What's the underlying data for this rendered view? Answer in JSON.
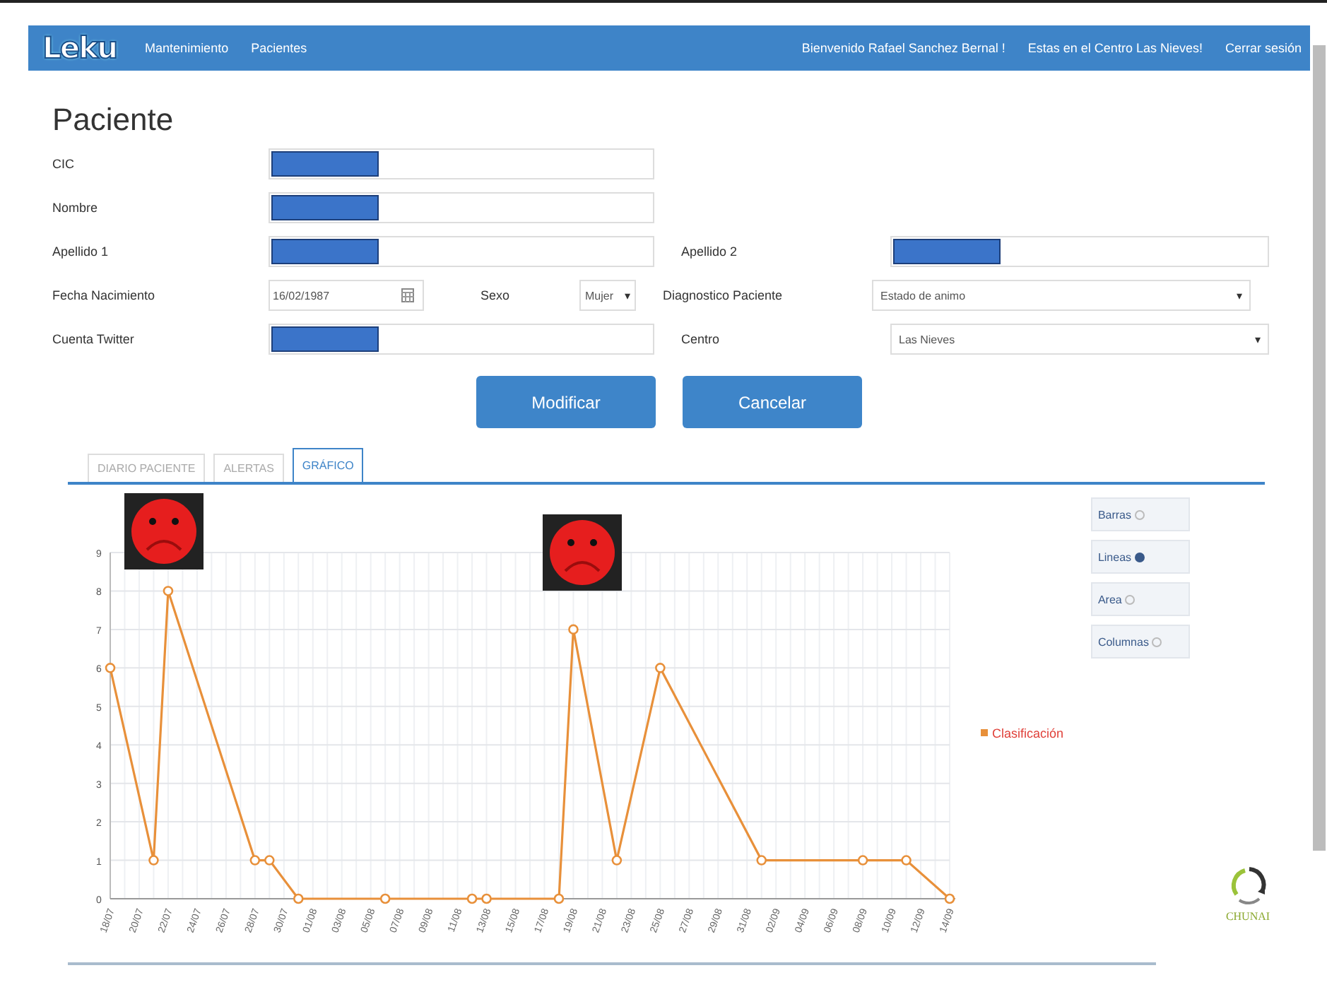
{
  "navbar": {
    "logo": "Leku",
    "links": [
      "Mantenimiento",
      "Pacientes"
    ],
    "user_links": [
      "Bienvenido Rafael Sanchez Bernal !",
      "Estas en el Centro Las Nieves!",
      "Cerrar sesión"
    ]
  },
  "title": "Paciente",
  "form": {
    "cic": {
      "label": "CIC",
      "redacted": true
    },
    "nombre": {
      "label": "Nombre",
      "redacted": true
    },
    "apellido_1": {
      "label": "Apellido 1",
      "redacted": true
    },
    "apellido_2": {
      "label": "Apellido 2",
      "redacted": true
    },
    "fecha_nacimiento": {
      "label": "Fecha Nacimiento",
      "value": "16/02/1987"
    },
    "sexo": {
      "label": "Sexo",
      "value": "Mujer",
      "caret": "▾"
    },
    "diagnostico": {
      "label": "Diagnostico Paciente",
      "value": "Estado de animo",
      "caret": "▾"
    },
    "cuenta_twitter": {
      "label": "Cuenta Twitter",
      "redacted": true
    },
    "centro": {
      "label": "Centro",
      "value": "Las Nieves",
      "caret": "▾"
    }
  },
  "buttons": [
    "Modificar",
    "Cancelar"
  ],
  "tabs": [
    {
      "label": "DIARIO PACIENTE",
      "selected": false
    },
    {
      "label": "ALERTAS",
      "selected": false
    },
    {
      "label": "GRÁFICO",
      "selected": true
    }
  ],
  "chart_types": [
    {
      "label": "Barras",
      "selected": false
    },
    {
      "label": "Lineas",
      "selected": true
    },
    {
      "label": "Area",
      "selected": false
    },
    {
      "label": "Columnas",
      "selected": false
    }
  ],
  "chart_data": {
    "type": "line",
    "categories": [
      "18/07",
      null,
      "20/07",
      null,
      "22/07",
      null,
      "24/07",
      null,
      "26/07",
      null,
      "28/07",
      null,
      "30/07",
      null,
      "01/08",
      null,
      "03/08",
      null,
      "05/08",
      null,
      "07/08",
      null,
      "09/08",
      null,
      "11/08",
      null,
      "13/08",
      null,
      "15/08",
      null,
      "17/08",
      null,
      "19/08",
      null,
      "21/08",
      null,
      "23/08",
      null,
      "25/08",
      null,
      "27/08",
      null,
      "29/08",
      null,
      "31/08",
      null,
      "02/09",
      null,
      "04/09",
      null,
      "06/09",
      null,
      "08/09",
      null,
      "10/09",
      null,
      "12/09",
      null,
      "14/09"
    ],
    "grid": true,
    "series": [
      {
        "name": "Clasificación",
        "color": "#e8903a",
        "marker": "circle",
        "values": [
          6,
          null,
          null,
          1,
          8,
          null,
          null,
          null,
          null,
          null,
          1,
          1,
          null,
          0,
          null,
          null,
          null,
          null,
          null,
          0,
          null,
          null,
          null,
          null,
          null,
          0,
          0,
          null,
          null,
          null,
          null,
          0,
          7,
          null,
          null,
          1,
          null,
          null,
          6,
          null,
          null,
          null,
          null,
          null,
          null,
          1,
          null,
          null,
          null,
          null,
          null,
          null,
          1,
          null,
          null,
          1,
          null,
          null,
          0
        ]
      }
    ],
    "ylim": [
      0,
      9
    ],
    "yticks": [
      0,
      1,
      2,
      3,
      4,
      5,
      6,
      7,
      8,
      9
    ]
  },
  "footer_logo": "CHUNAI"
}
